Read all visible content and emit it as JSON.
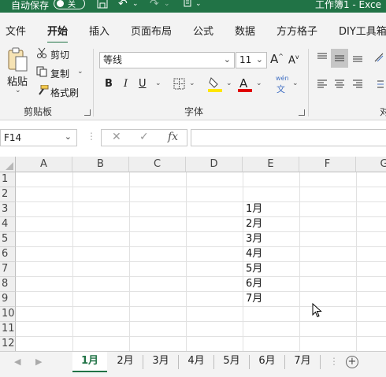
{
  "titlebar": {
    "autosave_label": "自动保存",
    "autosave_state": "关",
    "document_title": "工作簿1 - Exce"
  },
  "ribbon_tabs": [
    "文件",
    "开始",
    "插入",
    "页面布局",
    "公式",
    "数据",
    "方方格子",
    "DIY工具箱"
  ],
  "active_ribbon_tab": "开始",
  "clipboard": {
    "paste": "粘贴",
    "cut": "剪切",
    "copy": "复制",
    "format_painter": "格式刷",
    "group_label": "剪贴板"
  },
  "font": {
    "name": "等线",
    "size": "11",
    "bold": "B",
    "italic": "I",
    "underline": "U",
    "group_label": "字体",
    "phonetic_top": "wén",
    "phonetic_bottom": "文",
    "font_color": "A",
    "grow": "A",
    "shrink": "A",
    "highlight_color": "#ffe600",
    "font_color_value": "#e00000"
  },
  "alignment": {
    "group_label": "对"
  },
  "formula_bar": {
    "name_box": "F14",
    "fx": "fx",
    "formula": ""
  },
  "columns": [
    "A",
    "B",
    "C",
    "D",
    "E",
    "F",
    "G"
  ],
  "rows": [
    "1",
    "2",
    "3",
    "4",
    "5",
    "6",
    "7",
    "8",
    "9",
    "10",
    "11",
    "12"
  ],
  "cells_column_e": [
    "",
    "",
    "1月",
    "2月",
    "3月",
    "4月",
    "5月",
    "6月",
    "7月",
    "",
    "",
    ""
  ],
  "sheets": [
    "1月",
    "2月",
    "3月",
    "4月",
    "5月",
    "6月",
    "7月"
  ],
  "active_sheet": "1月",
  "colors": {
    "brand": "#217346"
  }
}
